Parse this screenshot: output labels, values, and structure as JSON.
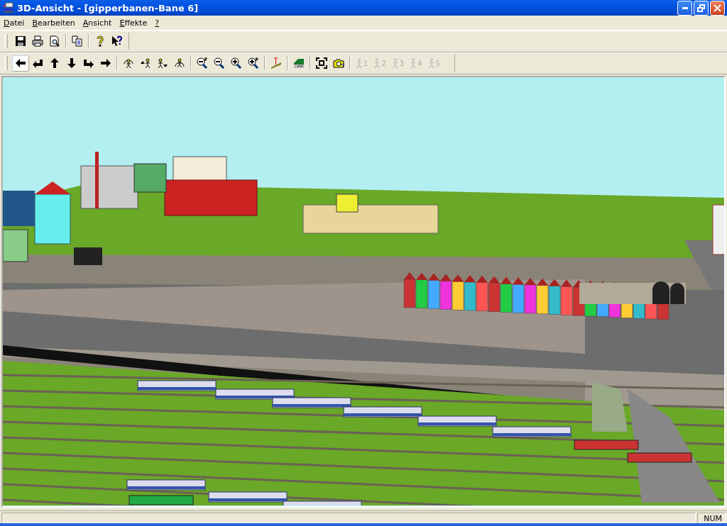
{
  "window": {
    "title": "3D-Ansicht - [gipperbanen-Bane 6]"
  },
  "menu": [
    {
      "label": "Datei"
    },
    {
      "label": "Bearbeiten"
    },
    {
      "label": "Ansicht"
    },
    {
      "label": "Effekte"
    },
    {
      "label": "?"
    }
  ],
  "toolbars": [
    {
      "groups": [
        [
          {
            "kind": "save",
            "disabled": false,
            "selected": false
          },
          {
            "kind": "print",
            "disabled": false,
            "selected": false
          },
          {
            "kind": "preview",
            "disabled": false,
            "selected": false
          }
        ],
        [
          {
            "kind": "copy",
            "disabled": false,
            "selected": false
          }
        ],
        [
          {
            "kind": "help",
            "disabled": false,
            "selected": false
          },
          {
            "kind": "context-help",
            "disabled": false,
            "selected": false
          }
        ]
      ]
    },
    {
      "groups": [
        [
          {
            "kind": "left",
            "disabled": false,
            "selected": true
          },
          {
            "kind": "turn-left",
            "disabled": false,
            "selected": false
          },
          {
            "kind": "up",
            "disabled": false,
            "selected": false
          },
          {
            "kind": "down",
            "disabled": false,
            "selected": false
          },
          {
            "kind": "turn-right",
            "disabled": false,
            "selected": false
          },
          {
            "kind": "right",
            "disabled": false,
            "selected": false
          }
        ],
        [
          {
            "kind": "figure-arc",
            "disabled": false,
            "selected": false
          },
          {
            "kind": "figure-up",
            "disabled": false,
            "selected": false
          },
          {
            "kind": "figure-down",
            "disabled": false,
            "selected": false
          },
          {
            "kind": "figure-arc-low",
            "disabled": false,
            "selected": false
          }
        ],
        [
          {
            "kind": "zoom-out-2",
            "disabled": false,
            "selected": false
          },
          {
            "kind": "zoom-out",
            "disabled": false,
            "selected": false
          },
          {
            "kind": "zoom-in",
            "disabled": false,
            "selected": false
          },
          {
            "kind": "zoom-in-2",
            "disabled": false,
            "selected": false
          }
        ],
        [
          {
            "kind": "height",
            "disabled": false,
            "selected": false
          }
        ],
        [
          {
            "kind": "slope",
            "disabled": false,
            "selected": false
          }
        ],
        [
          {
            "kind": "fit",
            "disabled": false,
            "selected": false
          },
          {
            "kind": "camera",
            "disabled": false,
            "selected": false
          }
        ],
        [
          {
            "kind": "position",
            "label": "1",
            "disabled": true,
            "selected": false
          },
          {
            "kind": "position",
            "label": "2",
            "disabled": true,
            "selected": false
          },
          {
            "kind": "position",
            "label": "3",
            "disabled": true,
            "selected": false
          },
          {
            "kind": "position",
            "label": "4",
            "disabled": true,
            "selected": false
          },
          {
            "kind": "position",
            "label": "5",
            "disabled": true,
            "selected": false
          }
        ]
      ]
    }
  ],
  "status_bar": {
    "indicators": [
      {
        "label": "NUM"
      }
    ]
  }
}
